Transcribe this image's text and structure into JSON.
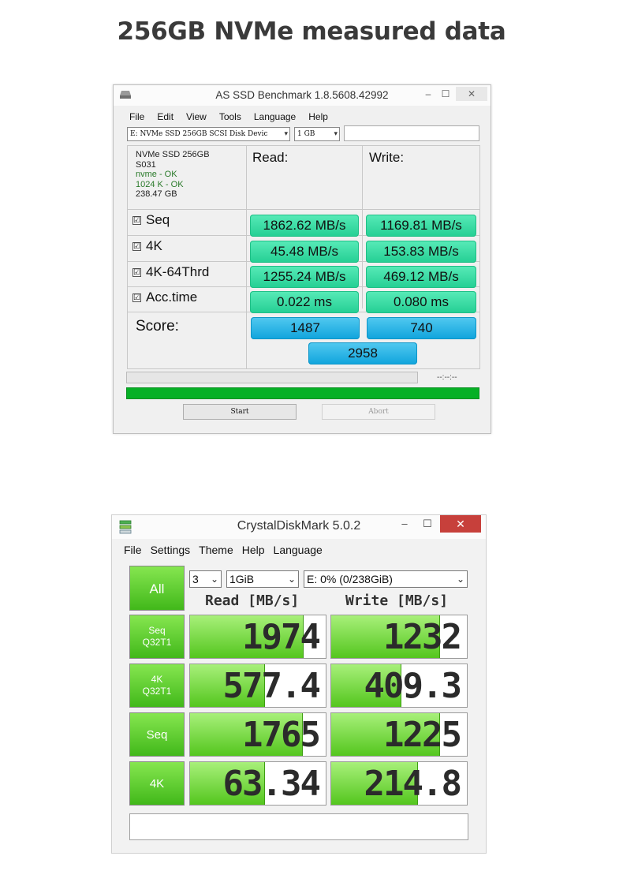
{
  "page_title": "256GB NVMe measured data",
  "asssd": {
    "title": "AS SSD Benchmark 1.8.5608.42992",
    "window_controls": {
      "minimize": "–",
      "maximize": "☐",
      "close": "✕"
    },
    "menu": [
      "File",
      "Edit",
      "View",
      "Tools",
      "Language",
      "Help"
    ],
    "drive_select": "E: NVMe SSD 256GB SCSI Disk Devic",
    "size_select": "1 GB",
    "drive_info": {
      "model": "NVMe SSD 256GB",
      "firmware": "S031",
      "driver": "nvme - OK",
      "alignment": "1024 K - OK",
      "capacity": "238.47 GB"
    },
    "read_header": "Read:",
    "write_header": "Write:",
    "rows": [
      {
        "label": "Seq",
        "checked": "☑",
        "read": "1862.62 MB/s",
        "write": "1169.81 MB/s"
      },
      {
        "label": "4K",
        "checked": "☑",
        "read": "45.48 MB/s",
        "write": "153.83 MB/s"
      },
      {
        "label": "4K-64Thrd",
        "checked": "☑",
        "read": "1255.24 MB/s",
        "write": "469.12 MB/s"
      },
      {
        "label": "Acc.time",
        "checked": "☑",
        "read": "0.022 ms",
        "write": "0.080 ms"
      }
    ],
    "score_label": "Score:",
    "score_read": "1487",
    "score_write": "740",
    "score_total": "2958",
    "time_elapsed": "--:--:--",
    "progress_fraction": 1.0,
    "start_button": "Start",
    "abort_button": "Abort",
    "colors": {
      "result": "#3ddca5",
      "score": "#2bb8ea",
      "progress": "#06b025"
    }
  },
  "cdm": {
    "title": "CrystalDiskMark 5.0.2",
    "window_controls": {
      "minimize": "–",
      "maximize": "☐",
      "close": "✕"
    },
    "menu": [
      "File",
      "Settings",
      "Theme",
      "Help",
      "Language"
    ],
    "all_button": "All",
    "count_select": "3",
    "size_select": "1GiB",
    "drive_select": "E: 0% (0/238GiB)",
    "read_header": "Read [MB/s]",
    "write_header": "Write [MB/s]",
    "rows": [
      {
        "line1": "Seq",
        "line2": "Q32T1",
        "read": "1974",
        "write": "1232",
        "read_fill": 0.84,
        "write_fill": 0.8
      },
      {
        "line1": "4K",
        "line2": "Q32T1",
        "read": "577.4",
        "write": "409.3",
        "read_fill": 0.55,
        "write_fill": 0.52
      },
      {
        "line1": "Seq",
        "line2": "",
        "read": "1765",
        "write": "1225",
        "read_fill": 0.83,
        "write_fill": 0.8
      },
      {
        "line1": "4K",
        "line2": "",
        "read": "63.34",
        "write": "214.8",
        "read_fill": 0.55,
        "write_fill": 0.64
      }
    ],
    "comment": "",
    "colors": {
      "bar": "#5bd024",
      "close_button": "#c7403b"
    }
  }
}
